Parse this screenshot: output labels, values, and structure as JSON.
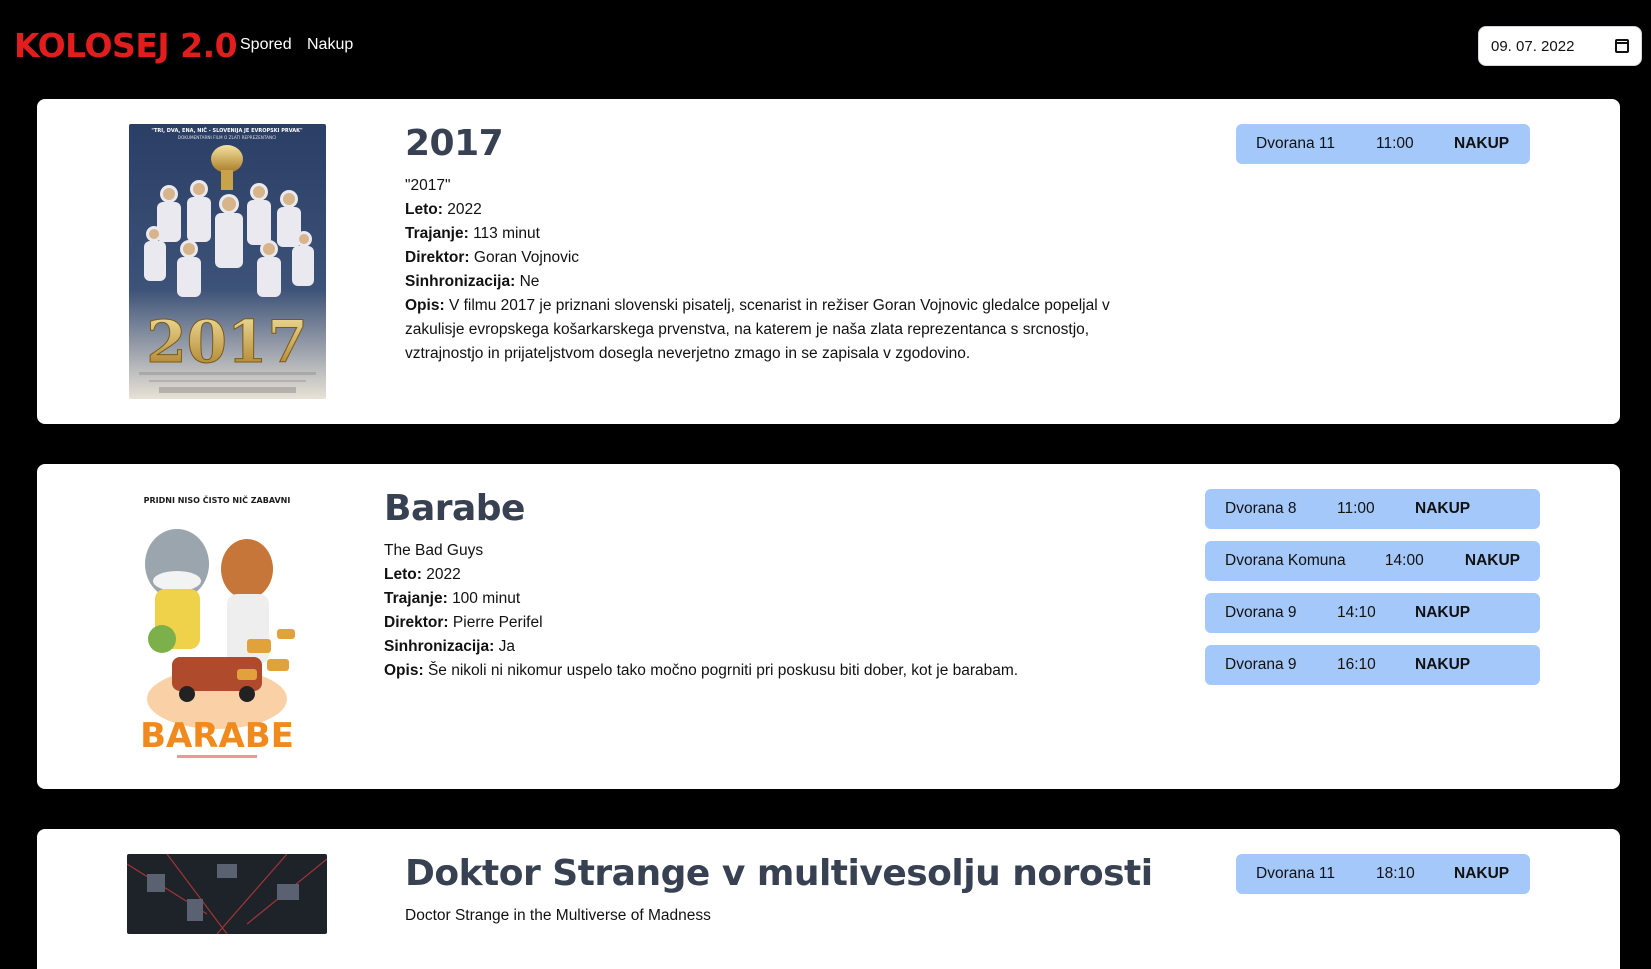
{
  "header": {
    "logo": "KOLOSEJ 2.0",
    "nav": [
      "Spored",
      "Nakup"
    ],
    "date_value": "09. 07. 2022",
    "calendar_icon": "calendar-icon"
  },
  "labels": {
    "year": "Leto:",
    "duration": "Trajanje:",
    "director": "Direktor:",
    "dubbed": "Sinhronizacija:",
    "description": "Opis:"
  },
  "movies": [
    {
      "title": "2017",
      "original_title": "\"2017\"",
      "year": "2022",
      "duration": "113 minut",
      "director": "Goran Vojnovic",
      "dubbed": "Ne",
      "description": "V filmu 2017 je priznani slovenski pisatelj, scenarist in režiser Goran Vojnovic gledalce popeljal v zakulisje evropskega košarkarskega prvenstva, na katerem je naša zlata reprezentanca s srcnostjo, vztrajnostjo in prijateljstvom dosegla neverjetno zmago in se zapisala v zgodovino.",
      "poster_text": "2017",
      "poster_tagline": "\"TRI, DVA, ENA, NIČ - SLOVENIJA JE EVROPSKI PRVAK\"",
      "poster_subtitle": "DOKUMENTARNI FILM O ZLATI REPREZENTANCI",
      "showtimes": [
        {
          "hall": "Dvorana 11",
          "time": "11:00",
          "action": "NAKUP"
        }
      ]
    },
    {
      "title": "Barabe",
      "original_title": "The Bad Guys",
      "year": "2022",
      "duration": "100 minut",
      "director": "Pierre Perifel",
      "dubbed": "Ja",
      "description": "Še nikoli ni nikomur uspelo tako močno pogrniti pri poskusu biti dober, kot je barabam.",
      "poster_text": "BARABE",
      "poster_tagline": "PRIDNI NISO ČISTO NIČ ZABAVNI",
      "showtimes": [
        {
          "hall": "Dvorana 8",
          "time": "11:00",
          "action": "NAKUP"
        },
        {
          "hall": "Dvorana Komuna",
          "time": "14:00",
          "action": "NAKUP"
        },
        {
          "hall": "Dvorana 9",
          "time": "14:10",
          "action": "NAKUP"
        },
        {
          "hall": "Dvorana 9",
          "time": "16:10",
          "action": "NAKUP"
        }
      ]
    },
    {
      "title": "Doktor Strange v multivesolju norosti",
      "original_title": "Doctor Strange in the Multiverse of Madness",
      "showtimes": [
        {
          "hall": "Dvorana 11",
          "time": "18:10",
          "action": "NAKUP"
        }
      ]
    }
  ]
}
